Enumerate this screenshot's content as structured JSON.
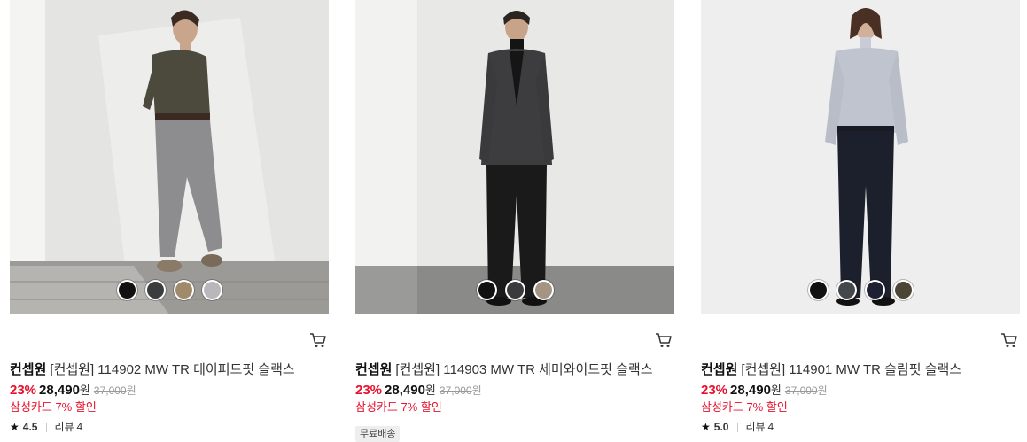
{
  "products": [
    {
      "brand": "컨셉원",
      "name": "[컨셉원] 114902 MW TR 테이퍼드핏 슬랙스",
      "discount": "23%",
      "price": "28,490",
      "won": "원",
      "original_price": "37,000",
      "card_discount": "삼성카드 7% 할인",
      "star": "★",
      "rating": "4.5",
      "review_label": "리뷰",
      "review_count": "4",
      "swatches": [
        "#111111",
        "#3a3c3e",
        "#a08a6c",
        "#b8b8bc"
      ]
    },
    {
      "brand": "컨셉원",
      "name": "[컨셉원] 114903 MW TR 세미와이드핏 슬랙스",
      "discount": "23%",
      "price": "28,490",
      "won": "원",
      "original_price": "37,000",
      "card_discount": "삼성카드 7% 할인",
      "badge": "무료배송",
      "swatches": [
        "#111111",
        "#3b3b3d",
        "#a39484"
      ]
    },
    {
      "brand": "컨셉원",
      "name": "[컨셉원] 114901 MW TR 슬림핏 슬랙스",
      "discount": "23%",
      "price": "28,490",
      "won": "원",
      "original_price": "37,000",
      "card_discount": "삼성카드 7% 할인",
      "star": "★",
      "rating": "5.0",
      "review_label": "리뷰",
      "review_count": "4",
      "swatches": [
        "#111111",
        "#45484a",
        "#1c2032",
        "#4a4535"
      ]
    }
  ],
  "icons": {
    "cart": "cart-icon",
    "star": "star-icon"
  },
  "colors": {
    "accent": "#e8112d",
    "muted": "#999999"
  }
}
